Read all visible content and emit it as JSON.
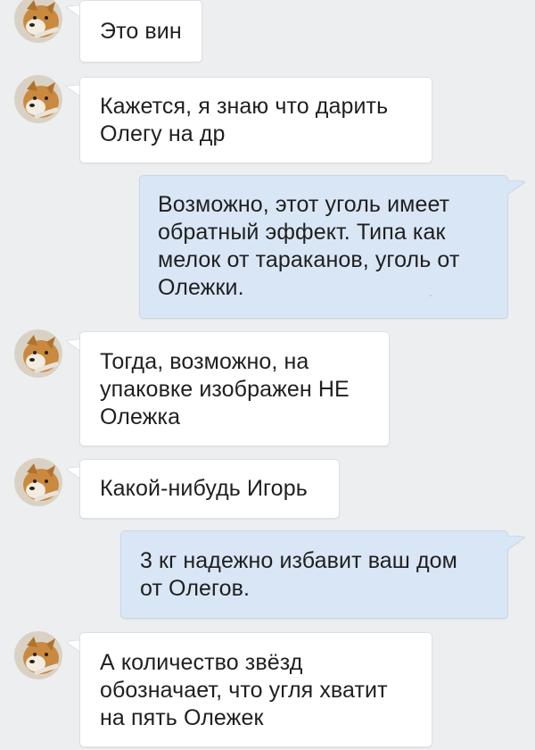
{
  "colors": {
    "background": "#edeef0",
    "incoming_bubble": "#ffffff",
    "outgoing_bubble": "#d9e6f6",
    "text": "#1f1f1f"
  },
  "messages": [
    {
      "direction": "incoming",
      "avatar": "dog-avatar-icon",
      "text": "Это вин"
    },
    {
      "direction": "incoming",
      "avatar": "dog-avatar-icon",
      "text": "Кажется, я знаю что дарить\nОлегу на др"
    },
    {
      "direction": "outgoing",
      "text": "Возможно, этот уголь имеет\nобратный эффект. Типа как\nмелок от тараканов, уголь от\nОлежки."
    },
    {
      "direction": "incoming",
      "avatar": "dog-avatar-icon",
      "text": "Тогда, возможно, на\nупаковке изображен НЕ\nОлежка"
    },
    {
      "direction": "incoming",
      "avatar": "dog-avatar-icon",
      "text": "Какой-нибудь Игорь"
    },
    {
      "direction": "outgoing",
      "text": "3 кг надежно избавит ваш дом\nот Олегов."
    },
    {
      "direction": "incoming",
      "avatar": "dog-avatar-icon",
      "text": "А количество звёзд\nобозначает, что угля хватит\nна пять Олежек"
    }
  ]
}
